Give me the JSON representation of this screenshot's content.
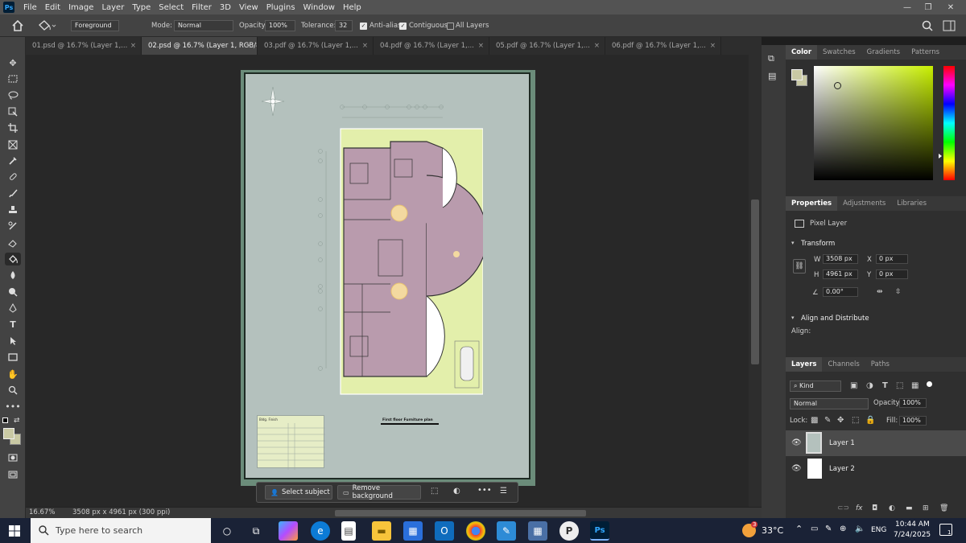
{
  "app": {
    "logo": "Ps"
  },
  "menu": [
    "File",
    "Edit",
    "Image",
    "Layer",
    "Type",
    "Select",
    "Filter",
    "3D",
    "View",
    "Plugins",
    "Window",
    "Help"
  ],
  "window_controls": {
    "minimize": "—",
    "restore": "❐",
    "close": "✕"
  },
  "options": {
    "preset": "Foreground",
    "mode_label": "Mode:",
    "mode_value": "Normal",
    "opacity_label": "Opacity:",
    "opacity_value": "100%",
    "tolerance_label": "Tolerance:",
    "tolerance_value": "32",
    "anti_alias": "Anti-alias",
    "contiguous": "Contiguous",
    "all_layers": "All Layers"
  },
  "tabs": [
    {
      "label": "01.psd @ 16.7% (Layer 1,...",
      "close": "×"
    },
    {
      "label": "02.psd @ 16.7% (Layer 1, RGB/8)",
      "close": "×"
    },
    {
      "label": "03.pdf @ 16.7% (Layer 1,...",
      "close": "×"
    },
    {
      "label": "04.pdf @ 16.7% (Layer 1,...",
      "close": "×"
    },
    {
      "label": "05.pdf @ 16.7% (Layer 1,...",
      "close": "×"
    },
    {
      "label": "06.pdf @ 16.7% (Layer 1,...",
      "close": "×"
    }
  ],
  "document": {
    "plan_title": "First floor Furniture plan",
    "legend_title": "Bldg. Finish"
  },
  "contextual_bar": {
    "select_subject": "Select subject",
    "remove_background": "Remove background"
  },
  "status": {
    "zoom": "16.67%",
    "doc_info": "3508 px x 4961 px (300 ppi)"
  },
  "color_panel": {
    "tabs": [
      "Color",
      "Swatches",
      "Gradients",
      "Patterns"
    ],
    "fg_color": "#c9c9a4",
    "bg_color": "#c9c9a4",
    "picker_hue": "#c8ef00"
  },
  "properties": {
    "tabs": [
      "Properties",
      "Adjustments",
      "Libraries"
    ],
    "layer_type": "Pixel Layer",
    "transform_title": "Transform",
    "w_label": "W",
    "w_value": "3508 px",
    "h_label": "H",
    "h_value": "4961 px",
    "x_label": "X",
    "x_value": "0 px",
    "y_label": "Y",
    "y_value": "0 px",
    "angle_value": "0.00°",
    "align_title": "Align and Distribute",
    "align_label": "Align:"
  },
  "layers": {
    "tabs": [
      "Layers",
      "Channels",
      "Paths"
    ],
    "kind": "Kind",
    "blend": "Normal",
    "opacity_label": "Opacity:",
    "opacity_value": "100%",
    "lock_label": "Lock:",
    "fill_label": "Fill:",
    "fill_value": "100%",
    "items": [
      {
        "name": "Layer 1"
      },
      {
        "name": "Layer 2"
      }
    ]
  },
  "taskbar": {
    "search_placeholder": "Type here to search",
    "temperature": "33°C",
    "weather_badge": "3",
    "language": "ENG",
    "time": "10:44 AM",
    "date": "7/24/2025",
    "notifications": "1"
  }
}
